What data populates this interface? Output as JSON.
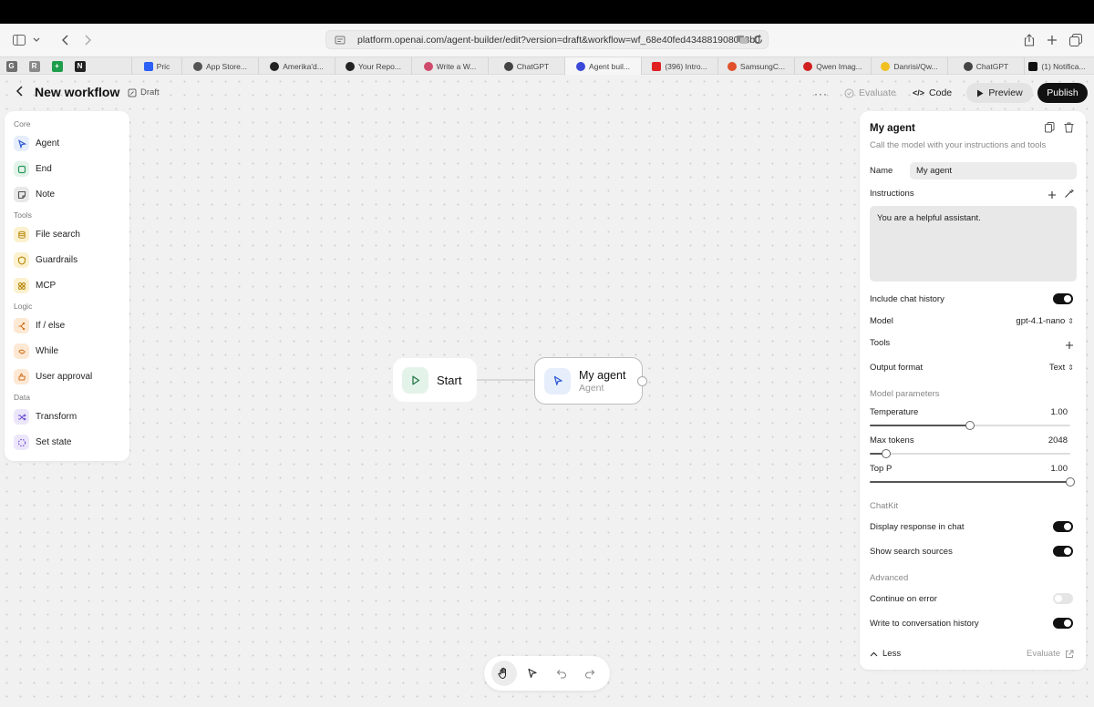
{
  "browser": {
    "url": "platform.openai.com/agent-builder/edit?version=draft&workflow=wf_68e40fed4348819080d8b0",
    "pinned_tabs": [
      {
        "letter": "G",
        "color": "#6e6e6e"
      },
      {
        "letter": "R",
        "color": "#8a8a8a"
      },
      {
        "letter": "+",
        "color": "#1e9e4a"
      },
      {
        "letter": "N",
        "color": "#222222"
      }
    ],
    "tabs": [
      {
        "label": "Pric",
        "color": "#2b5ff5",
        "icon": "brand-icon"
      },
      {
        "label": "App Store...",
        "color": "#555555",
        "icon": "apple-icon"
      },
      {
        "label": "Amerika'd...",
        "color": "#222222",
        "icon": "site-icon"
      },
      {
        "label": "Your Repo...",
        "color": "#222222",
        "icon": "github-icon"
      },
      {
        "label": "Write a W...",
        "color": "#d04b6b",
        "icon": "site-icon"
      },
      {
        "label": "ChatGPT",
        "color": "#444444",
        "icon": "chatgpt-icon"
      },
      {
        "label": "Agent buil...",
        "color": "#3a49d8",
        "icon": "openai-icon"
      },
      {
        "label": "(396) Intro...",
        "color": "#e02020",
        "icon": "youtube-icon"
      },
      {
        "label": "SamsungC...",
        "color": "#e0502a",
        "icon": "reddit-icon"
      },
      {
        "label": "Qwen Imag...",
        "color": "#d02020",
        "icon": "site-icon"
      },
      {
        "label": "Danrisi/Qw...",
        "color": "#f0c020",
        "icon": "huggingface-icon"
      },
      {
        "label": "ChatGPT",
        "color": "#444444",
        "icon": "chatgpt-icon"
      },
      {
        "label": "(1) Notifica...",
        "color": "#111111",
        "icon": "x-icon"
      }
    ]
  },
  "header": {
    "title": "New workflow",
    "draft_label": "Draft",
    "more_label": "···",
    "evaluate_label": "Evaluate",
    "code_label": "Code",
    "preview_label": "Preview",
    "publish_label": "Publish"
  },
  "palette": {
    "sections": [
      "Core",
      "Tools",
      "Logic",
      "Data"
    ],
    "items": [
      {
        "label": "Agent",
        "icon": "agent-icon",
        "bg": "#e6eefc",
        "color": "#2f5bd6"
      },
      {
        "label": "End",
        "icon": "end-icon",
        "bg": "#e3f3ea",
        "color": "#2b9a5a"
      },
      {
        "label": "Note",
        "icon": "note-icon",
        "bg": "#e8e8e8",
        "color": "#555555"
      },
      {
        "label": "File search",
        "icon": "file-search-icon",
        "bg": "#fbf1cf",
        "color": "#b7870b"
      },
      {
        "label": "Guardrails",
        "icon": "guardrails-icon",
        "bg": "#fbf1cf",
        "color": "#b7870b"
      },
      {
        "label": "MCP",
        "icon": "mcp-icon",
        "bg": "#fbf1cf",
        "color": "#b7870b"
      },
      {
        "label": "If / else",
        "icon": "if-else-icon",
        "bg": "#fde8d4",
        "color": "#d0701a"
      },
      {
        "label": "While",
        "icon": "while-icon",
        "bg": "#fde8d4",
        "color": "#d0701a"
      },
      {
        "label": "User approval",
        "icon": "user-approval-icon",
        "bg": "#fde8d4",
        "color": "#d0701a"
      },
      {
        "label": "Transform",
        "icon": "transform-icon",
        "bg": "#ece6fb",
        "color": "#6b4fd0"
      },
      {
        "label": "Set state",
        "icon": "set-state-icon",
        "bg": "#ece6fb",
        "color": "#6b4fd0"
      }
    ]
  },
  "canvas": {
    "start_node": {
      "label": "Start"
    },
    "agent_node": {
      "title": "My agent",
      "subtitle": "Agent"
    }
  },
  "panel": {
    "title": "My agent",
    "description": "Call the model with your instructions and tools",
    "name_label": "Name",
    "name_value": "My agent",
    "instructions_label": "Instructions",
    "instructions_value": "You are a helpful assistant.",
    "include_history_label": "Include chat history",
    "include_history": true,
    "model_label": "Model",
    "model_value": "gpt-4.1-nano",
    "tools_label": "Tools",
    "output_format_label": "Output format",
    "output_format_value": "Text",
    "model_params_label": "Model parameters",
    "temperature_label": "Temperature",
    "temperature_value": "1.00",
    "temperature_fraction": 0.5,
    "max_tokens_label": "Max tokens",
    "max_tokens_value": "2048",
    "max_tokens_fraction": 0.08,
    "top_p_label": "Top P",
    "top_p_value": "1.00",
    "top_p_fraction": 1.0,
    "chatkit_label": "ChatKit",
    "display_response_label": "Display response in chat",
    "display_response": true,
    "show_sources_label": "Show search sources",
    "show_sources": true,
    "advanced_label": "Advanced",
    "continue_on_error_label": "Continue on error",
    "continue_on_error": false,
    "write_history_label": "Write to conversation history",
    "write_history": true,
    "less_label": "Less",
    "evaluate_label": "Evaluate"
  }
}
